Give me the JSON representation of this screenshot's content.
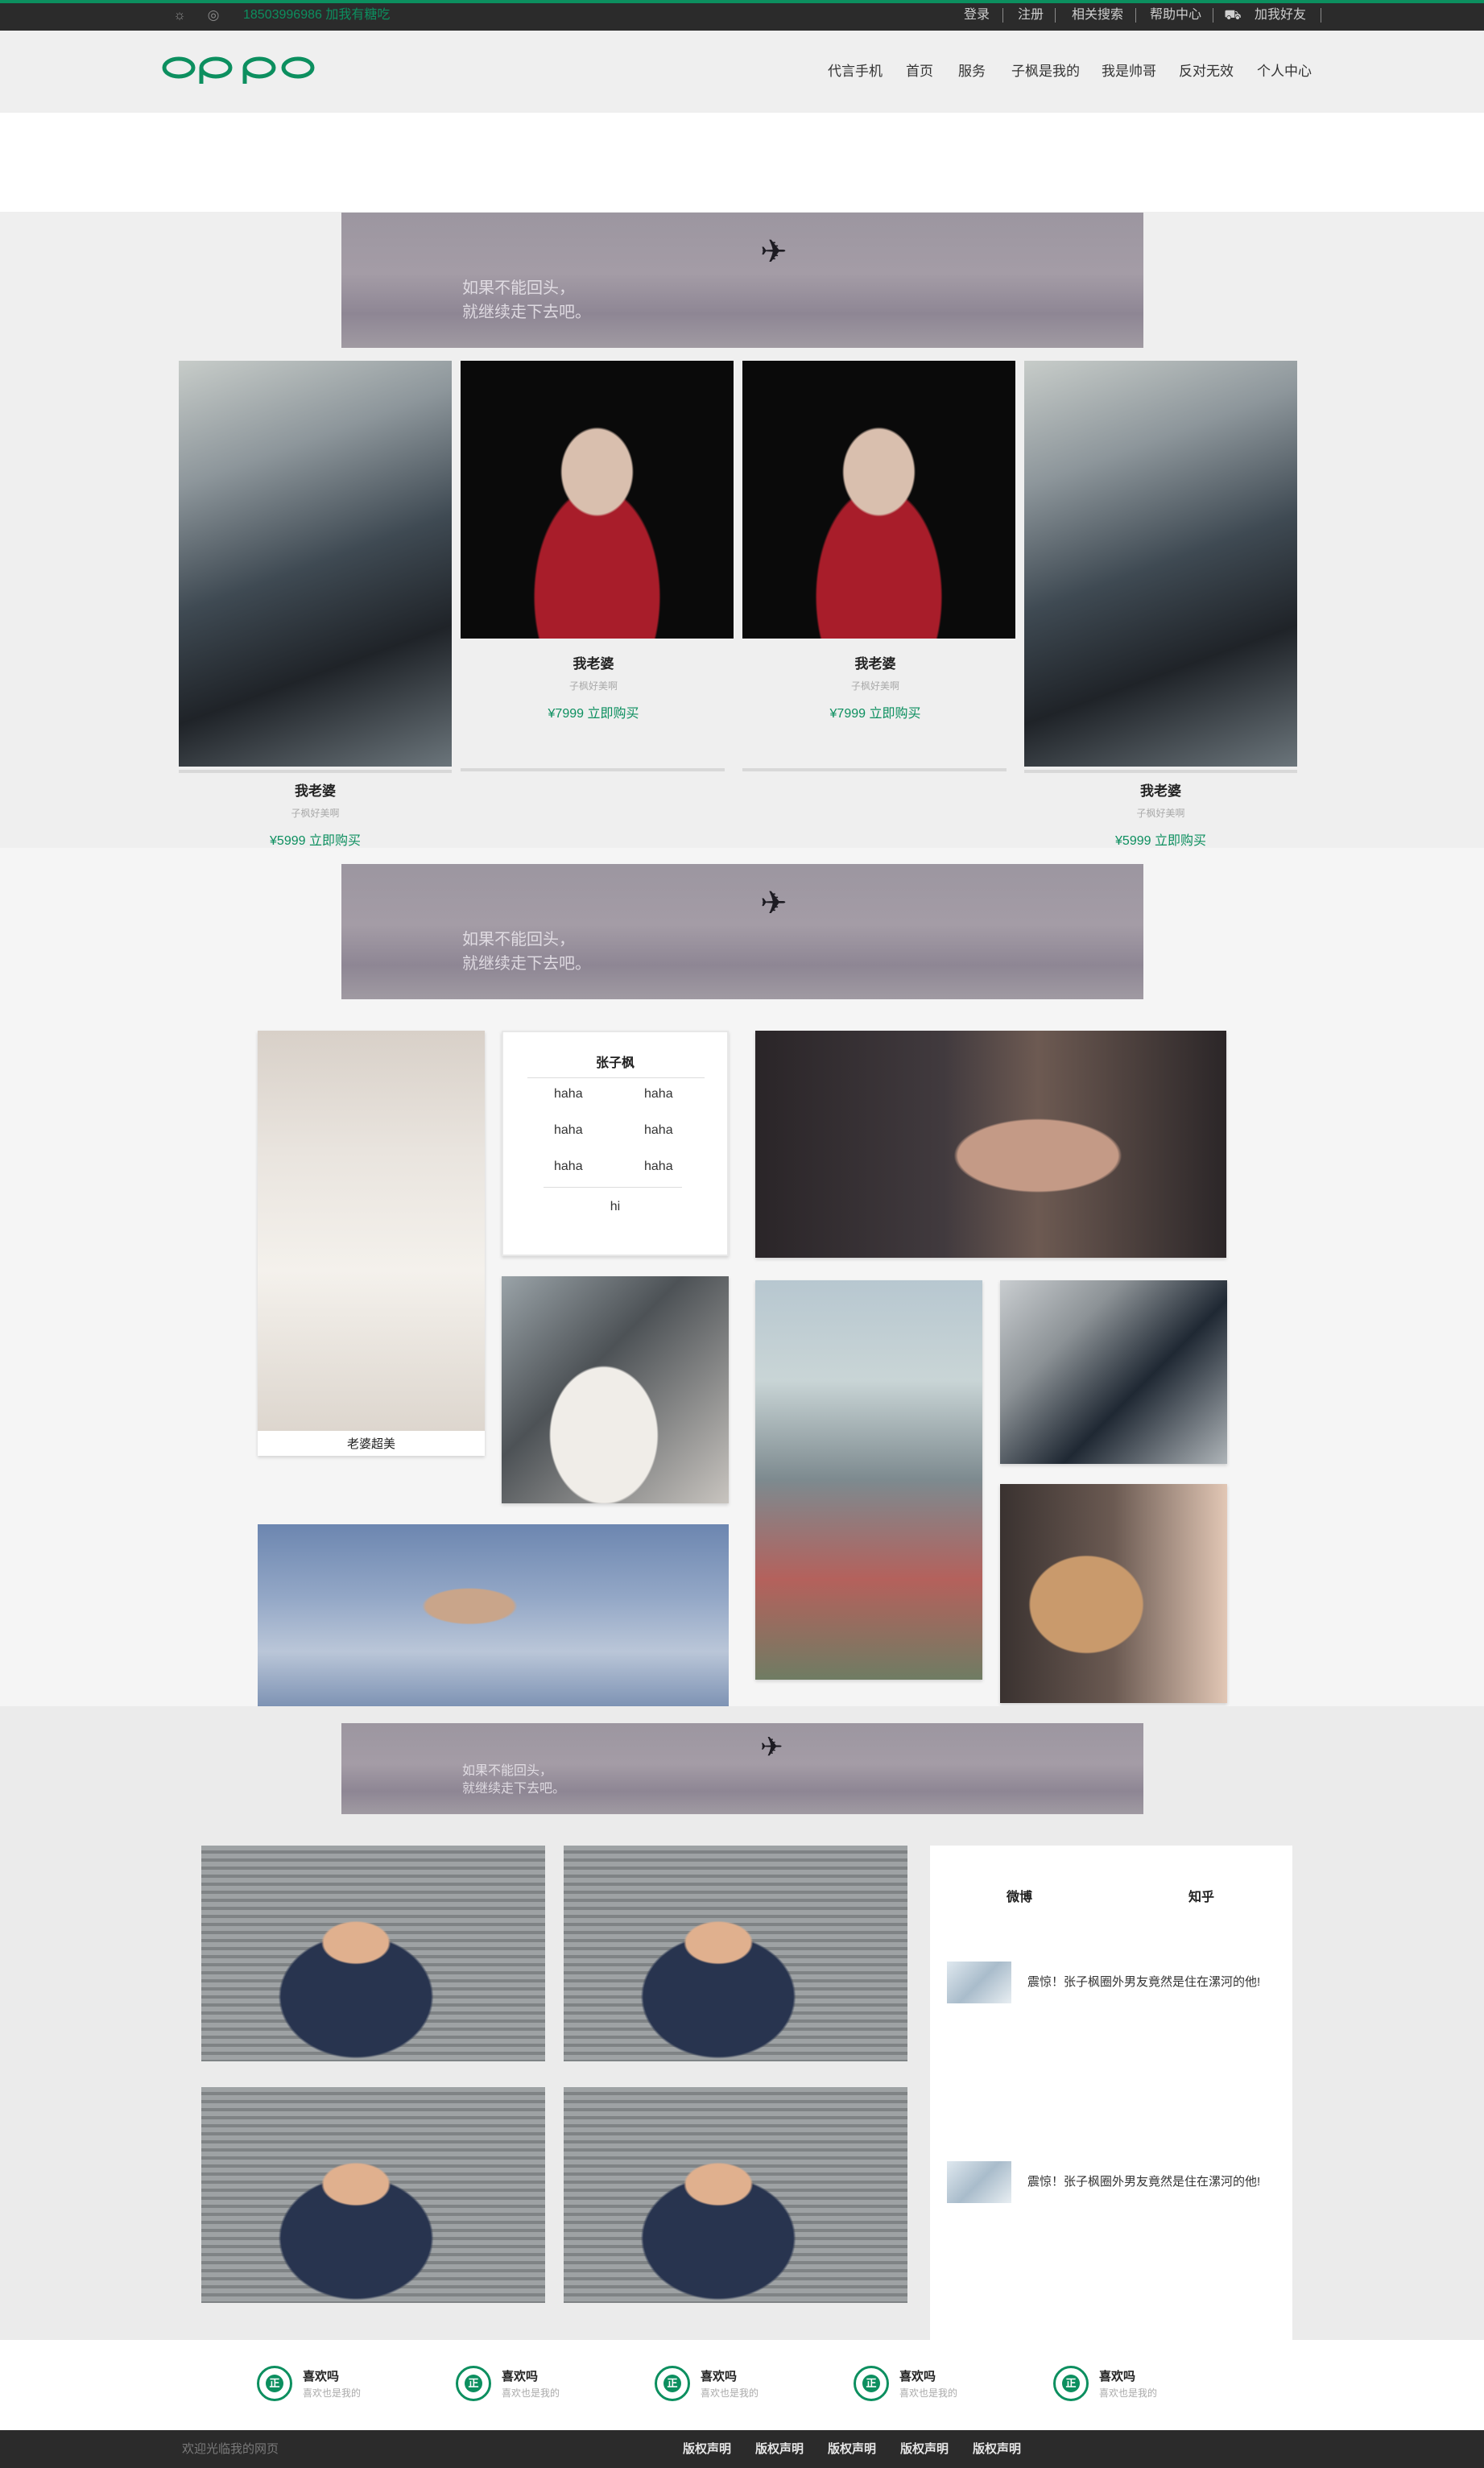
{
  "topbar": {
    "phone": "18503996986 加我有糖吃",
    "links": [
      "登录",
      "注册",
      "相关搜索",
      "帮助中心",
      "加我好友"
    ],
    "icons": [
      "weibo-icon",
      "chat-icon",
      "cart-icon"
    ]
  },
  "header": {
    "logo": "oppo",
    "nav": [
      "代言手机",
      "首页",
      "服务",
      "子枫是我的",
      "我是帅哥",
      "反对无效",
      "个人中心"
    ]
  },
  "products": {
    "cards": [
      {
        "title": "我老婆",
        "sub": "子枫好美啊",
        "price": "¥5999 立即购买"
      },
      {
        "title": "我老婆",
        "sub": "子枫好美啊",
        "price": "¥7999 立即购买"
      },
      {
        "title": "我老婆",
        "sub": "子枫好美啊",
        "price": "¥7999 立即购买"
      },
      {
        "title": "我老婆",
        "sub": "子枫好美啊",
        "price": "¥5999 立即购买"
      }
    ]
  },
  "banner": {
    "line1": "如果不能回头，",
    "line2": "就继续走下去吧。"
  },
  "gallery": {
    "caption": "老婆超美",
    "info": {
      "title": "张子枫",
      "cells": [
        "haha",
        "haha",
        "haha",
        "haha",
        "haha",
        "haha"
      ],
      "footer": "hi"
    }
  },
  "social": {
    "tabs": [
      "微博",
      "知乎"
    ],
    "news": [
      "震惊！张子枫圈外男友竟然是住在漯河的他!",
      "震惊！张子枫圈外男友竟然是住在漯河的他!"
    ]
  },
  "badges": {
    "icon_text": "正",
    "items": [
      {
        "title": "喜欢吗",
        "sub": "喜欢也是我的"
      },
      {
        "title": "喜欢吗",
        "sub": "喜欢也是我的"
      },
      {
        "title": "喜欢吗",
        "sub": "喜欢也是我的"
      },
      {
        "title": "喜欢吗",
        "sub": "喜欢也是我的"
      },
      {
        "title": "喜欢吗",
        "sub": "喜欢也是我的"
      }
    ]
  },
  "footer": {
    "welcome": "欢迎光临我的网页",
    "links": [
      "版权声明",
      "版权声明",
      "版权声明",
      "版权声明",
      "版权声明"
    ]
  },
  "colors": {
    "accent": "#0c8f5f",
    "bar": "#2b2b2b",
    "header": "#efefef"
  }
}
